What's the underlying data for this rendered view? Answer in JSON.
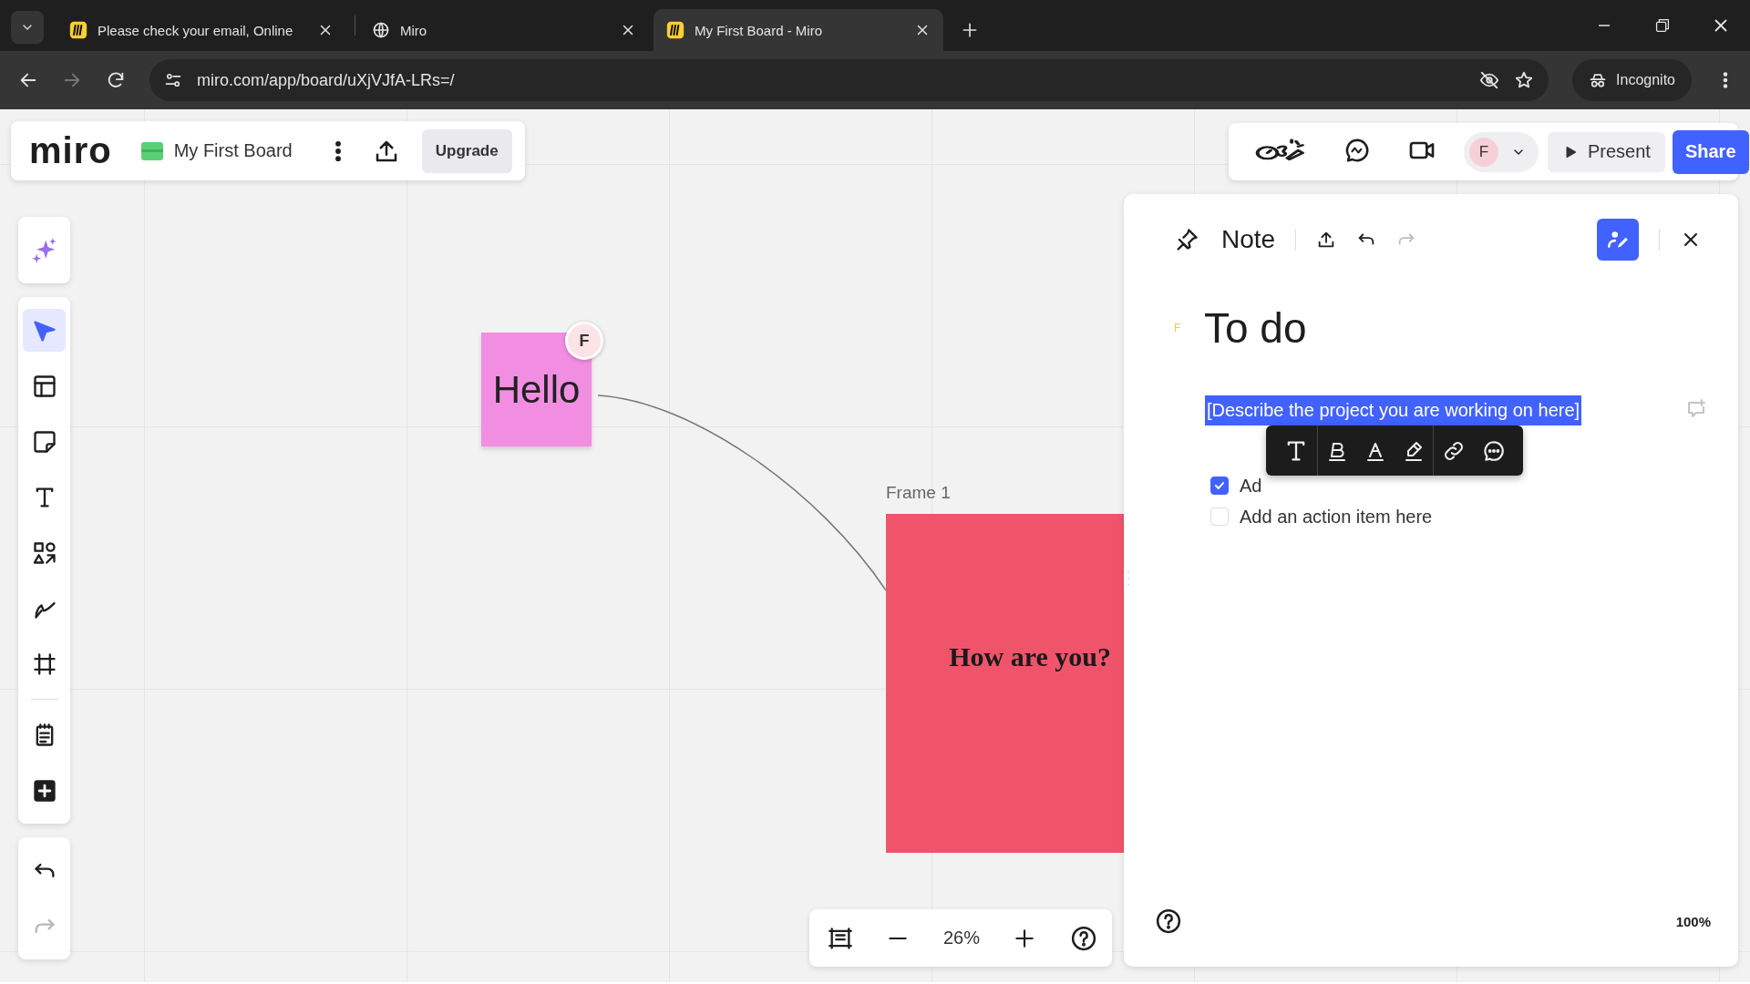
{
  "browser": {
    "tabs": [
      {
        "title": "Please check your email, Online",
        "kind": "miro",
        "selected": false
      },
      {
        "title": "Miro",
        "kind": "globe",
        "selected": false
      },
      {
        "title": "My First Board - Miro",
        "kind": "miro",
        "selected": true
      }
    ],
    "address": "miro.com/app/board/uXjVJfA-LRs=/",
    "profile": "Incognito"
  },
  "board_bar": {
    "logo": "miro",
    "name": "My First Board",
    "upgrade": "Upgrade"
  },
  "collab_bar": {
    "avatar": "F",
    "present": "Present",
    "share": "Share"
  },
  "tools": [
    {
      "kind": "select",
      "selected": true
    },
    {
      "kind": "templates",
      "selected": false
    },
    {
      "kind": "sticky",
      "selected": false
    },
    {
      "kind": "text",
      "selected": false
    },
    {
      "kind": "shapes",
      "selected": false
    },
    {
      "kind": "pen",
      "selected": false
    },
    {
      "kind": "frame",
      "selected": false
    }
  ],
  "apps": [
    {
      "kind": "notes"
    },
    {
      "kind": "add"
    }
  ],
  "history": [
    {
      "kind": "undo",
      "disabled": false
    },
    {
      "kind": "redo",
      "disabled": true
    }
  ],
  "canvas": {
    "sticky": {
      "text": "Hello",
      "avatar": "F"
    },
    "frame": {
      "title": "Frame 1",
      "text": "How are you?"
    }
  },
  "zoom": "26%",
  "note_panel": {
    "title": "Note",
    "history": [
      {
        "kind": "undo",
        "disabled": false
      },
      {
        "kind": "redo",
        "disabled": true
      }
    ],
    "author": "F",
    "heading": "To do",
    "description": "[Describe the project you are working on here]",
    "checklist": [
      {
        "text": "Ad",
        "checked": true
      },
      {
        "text": "Add an action item here",
        "checked": false
      }
    ],
    "zoom": "100%"
  }
}
